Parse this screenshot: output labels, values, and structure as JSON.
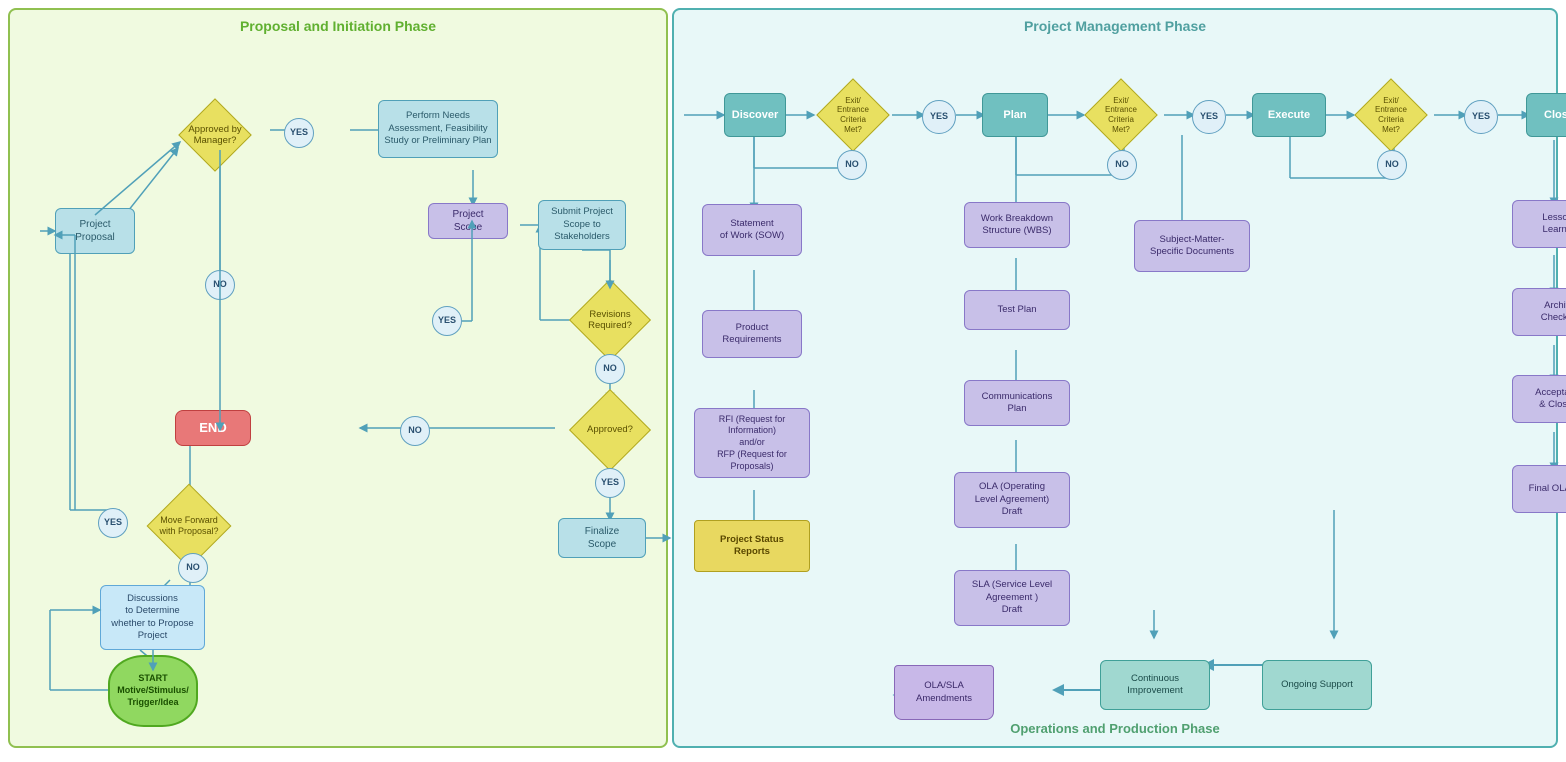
{
  "phases": {
    "left_title": "Proposal and Initiation Phase",
    "right_title": "Project Management Phase",
    "ops_title": "Operations and Production Phase"
  },
  "left_nodes": {
    "project_proposal": "Project\nProposal",
    "approved_by_manager": "Approved by\nManager?",
    "yes1": "YES",
    "perform_needs": "Perform Needs\nAssessment, Feasibility\nStudy or Preliminary Plan",
    "project_scope": "Project\nScope",
    "submit_scope": "Submit Project\nScope to\nStakeholders",
    "revisions_required": "Revisions\nRequired?",
    "yes2": "YES",
    "no1": "NO",
    "no2": "NO",
    "approved": "Approved?",
    "no3": "NO",
    "yes3": "YES",
    "end": "END",
    "finalize_scope": "Finalize\nScope",
    "move_forward": "Move Forward\nwith Proposal?",
    "yes4": "YES",
    "no4": "NO",
    "discussions": "Discussions\nto Determine\nwhether to Propose\nProject",
    "start": "START\nMotive/Stimulus/\nTrigger/Idea"
  },
  "right_nodes": {
    "discover": "Discover",
    "exit1": "Exit/\nEntrance\nCriteria\nMet?",
    "yes_r1": "YES",
    "no_r1": "NO",
    "plan": "Plan",
    "exit2": "Exit/\nEntrance\nCriteria\nMet?",
    "yes_r2": "YES",
    "no_r2": "NO",
    "execute": "Execute",
    "exit3": "Exit/\nEntrance\nCriteria\nMet?",
    "yes_r3": "YES",
    "no_r3": "NO",
    "close": "Close",
    "sow": "Statement\nof Work (SOW)",
    "product_req": "Product\nRequirements",
    "rfi": "RFI (Request for\nInformation)\nand/or\nRFP (Request for\nProposals)",
    "project_status": "Project Status\nReports",
    "wbs": "Work Breakdown\nStructure (WBS)",
    "test_plan": "Test Plan",
    "subject_matter": "Subject-Matter-\nSpecific Documents",
    "comms_plan": "Communications\nPlan",
    "ola_draft": "OLA (Operating\nLevel Agreement)\nDraft",
    "sla_draft": "SLA (Service Level\nAgreement )\nDraft",
    "lessons_learned": "Lessons\nLearned",
    "archive_checklist": "Archive\nChecklist",
    "acceptance": "Acceptance\n& Closure",
    "final_ola": "Final OLA/SLA"
  },
  "ops_nodes": {
    "continuous_improvement": "Continuous\nImprovement",
    "ongoing_support": "Ongoing\nSupport",
    "ola_amendments": "OLA/SLA\nAmendments"
  }
}
